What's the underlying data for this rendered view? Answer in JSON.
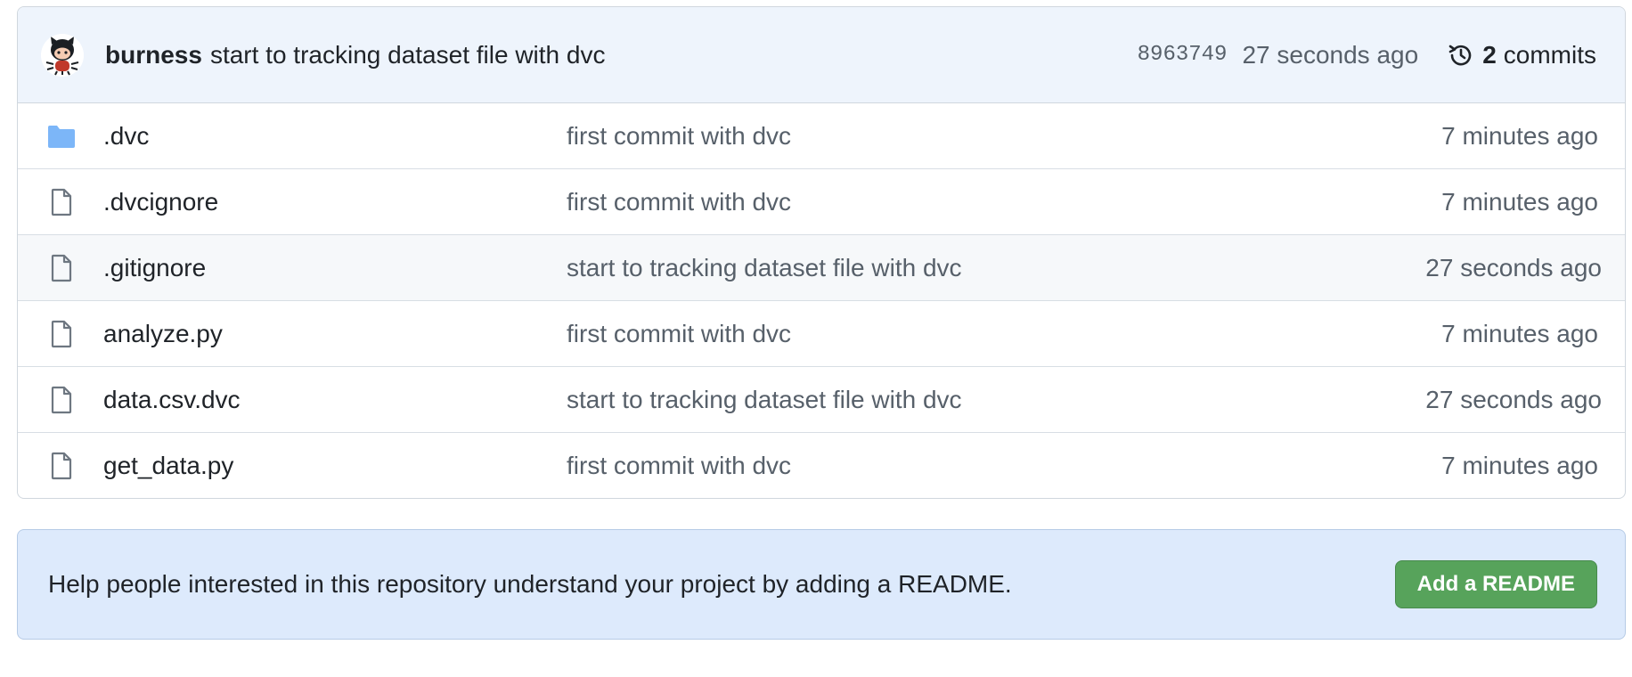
{
  "commit": {
    "author": "burness",
    "message": "start to tracking dataset file with dvc",
    "sha": "8963749",
    "time": "27 seconds ago",
    "commit_count": "2",
    "commits_label": "commits"
  },
  "files": [
    {
      "name": ".dvc",
      "type": "folder",
      "message": "first commit with dvc",
      "age": "7 minutes ago"
    },
    {
      "name": ".dvcignore",
      "type": "file",
      "message": "first commit with dvc",
      "age": "7 minutes ago"
    },
    {
      "name": ".gitignore",
      "type": "file",
      "message": "start to tracking dataset file with dvc",
      "age": "27 seconds ago"
    },
    {
      "name": "analyze.py",
      "type": "file",
      "message": "first commit with dvc",
      "age": "7 minutes ago"
    },
    {
      "name": "data.csv.dvc",
      "type": "file",
      "message": "start to tracking dataset file with dvc",
      "age": "27 seconds ago"
    },
    {
      "name": "get_data.py",
      "type": "file",
      "message": "first commit with dvc",
      "age": "7 minutes ago"
    }
  ],
  "readme": {
    "text": "Help people interested in this repository understand your project by adding a README.",
    "button_label": "Add a README"
  },
  "colors": {
    "folder": "#7cb6f8",
    "file_icon": "#6e7781",
    "button": "#57a35b",
    "banner": "#ddeafc"
  }
}
